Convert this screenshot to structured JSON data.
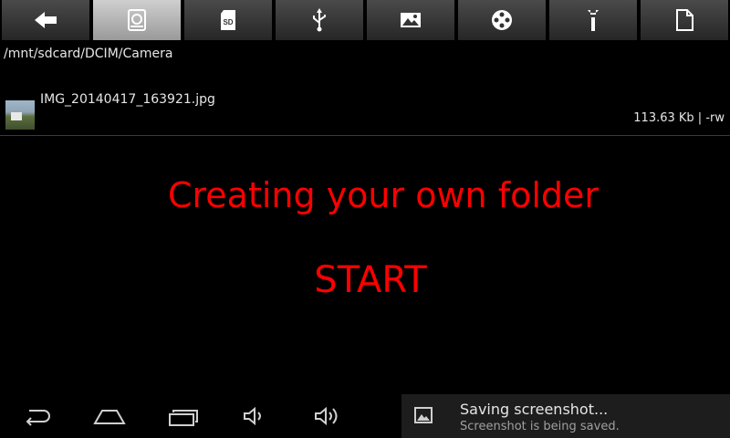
{
  "toolbar": {
    "buttons": [
      {
        "icon": "back-arrow-icon",
        "active": false
      },
      {
        "icon": "internal-storage-icon",
        "active": true
      },
      {
        "icon": "sd-card-icon",
        "active": false
      },
      {
        "icon": "usb-icon",
        "active": false
      },
      {
        "icon": "image-icon",
        "active": false
      },
      {
        "icon": "film-reel-icon",
        "active": false
      },
      {
        "icon": "wrench-icon",
        "active": false
      },
      {
        "icon": "document-icon",
        "active": false
      }
    ],
    "sd_label": "SD"
  },
  "path": "/mnt/sdcard/DCIM/Camera",
  "file": {
    "name": "IMG_20140417_163921.jpg",
    "meta": "113.63 Kb  | -rw"
  },
  "overlay": {
    "heading": "Creating your own folder",
    "start": "START",
    "color": "#ff0000"
  },
  "navbar": {
    "icons": [
      "back-icon",
      "home-icon",
      "recent-apps-icon",
      "volume-down-icon",
      "volume-up-icon"
    ]
  },
  "toast": {
    "title": "Saving screenshot...",
    "subtitle": "Screenshot is being saved."
  }
}
